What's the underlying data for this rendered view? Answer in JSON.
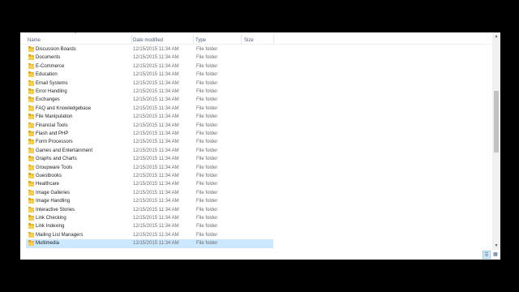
{
  "columns": {
    "name": "Name",
    "date_modified": "Date modified",
    "type": "Type",
    "size": "Size"
  },
  "rows": [
    {
      "name": "Discussion Boards",
      "date": "12/15/2015 11:34 AM",
      "type": "File folder"
    },
    {
      "name": "Documents",
      "date": "12/15/2015 11:34 AM",
      "type": "File folder"
    },
    {
      "name": "E-Commerce",
      "date": "12/15/2015 11:34 AM",
      "type": "File folder"
    },
    {
      "name": "Education",
      "date": "12/15/2015 11:34 AM",
      "type": "File folder"
    },
    {
      "name": "Email Systems",
      "date": "12/15/2015 11:34 AM",
      "type": "File folder"
    },
    {
      "name": "Error Handling",
      "date": "12/15/2015 11:34 AM",
      "type": "File folder"
    },
    {
      "name": "Exchanges",
      "date": "12/15/2015 11:34 AM",
      "type": "File folder"
    },
    {
      "name": "FAQ and Knowledgebase",
      "date": "12/15/2015 11:34 AM",
      "type": "File folder"
    },
    {
      "name": "File Manipulation",
      "date": "12/15/2015 11:34 AM",
      "type": "File folder"
    },
    {
      "name": "Financial Tools",
      "date": "12/15/2015 11:34 AM",
      "type": "File folder"
    },
    {
      "name": "Flash and PHP",
      "date": "12/15/2015 11:34 AM",
      "type": "File folder"
    },
    {
      "name": "Form Processors",
      "date": "12/15/2015 11:34 AM",
      "type": "File folder"
    },
    {
      "name": "Games and Entertainment",
      "date": "12/15/2015 11:34 AM",
      "type": "File folder"
    },
    {
      "name": "Graphs and Charts",
      "date": "12/15/2015 11:34 AM",
      "type": "File folder"
    },
    {
      "name": "Groupware Tools",
      "date": "12/15/2015 11:34 AM",
      "type": "File folder"
    },
    {
      "name": "Guestbooks",
      "date": "12/15/2015 11:34 AM",
      "type": "File folder"
    },
    {
      "name": "Healthcare",
      "date": "12/15/2015 11:34 AM",
      "type": "File folder"
    },
    {
      "name": "Image Galleries",
      "date": "12/15/2015 11:34 AM",
      "type": "File folder"
    },
    {
      "name": "Image Handling",
      "date": "12/15/2015 11:34 AM",
      "type": "File folder"
    },
    {
      "name": "Interactive Stories",
      "date": "12/15/2015 11:34 AM",
      "type": "File folder"
    },
    {
      "name": "Link Checking",
      "date": "12/15/2015 11:34 AM",
      "type": "File folder"
    },
    {
      "name": "Link Indexing",
      "date": "12/15/2015 11:34 AM",
      "type": "File folder"
    },
    {
      "name": "Mailing List Managers",
      "date": "12/15/2015 11:34 AM",
      "type": "File folder"
    },
    {
      "name": "Multimedia",
      "date": "12/15/2015 11:34 AM",
      "type": "File folder",
      "selected": true
    }
  ],
  "icons": {
    "folder": "folder-icon",
    "sort": "sort-ascending-icon",
    "details_view": "details-view-icon",
    "large_icons_view": "large-icons-view-icon"
  },
  "colors": {
    "selection": "#cce8ff",
    "folder": "#e8b931",
    "header_text": "#4c607a"
  }
}
